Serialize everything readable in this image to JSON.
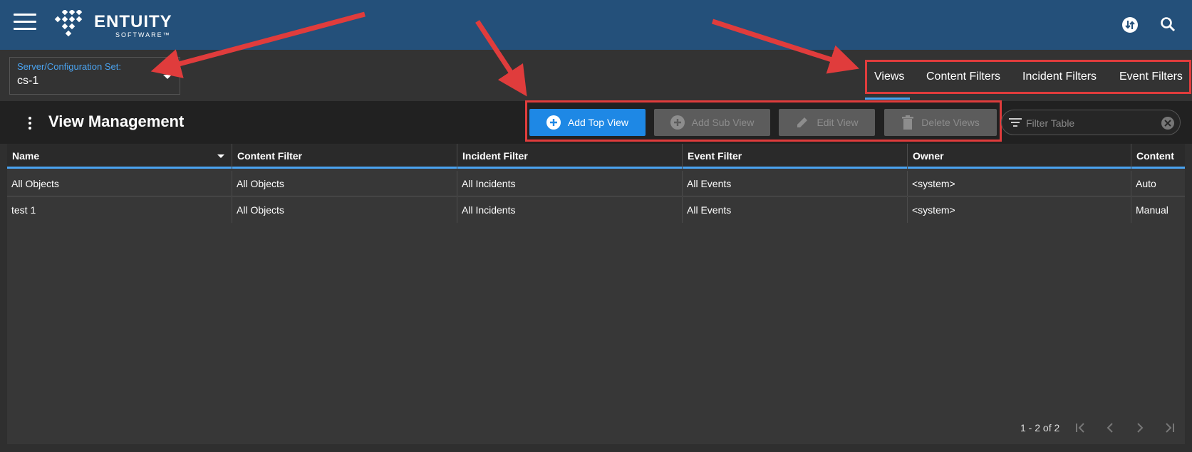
{
  "app": {
    "brand": "ENTUITY",
    "brand_sub": "SOFTWARE™"
  },
  "server_select": {
    "label": "Server/Configuration Set:",
    "value": "cs-1"
  },
  "tabs": [
    {
      "label": "Views",
      "active": true
    },
    {
      "label": "Content Filters",
      "active": false
    },
    {
      "label": "Incident Filters",
      "active": false
    },
    {
      "label": "Event Filters",
      "active": false
    }
  ],
  "page": {
    "title": "View Management"
  },
  "toolbar": {
    "add_top_view": "Add Top View",
    "add_sub_view": "Add Sub View",
    "edit_view": "Edit View",
    "delete_views": "Delete Views",
    "filter_placeholder": "Filter Table"
  },
  "table": {
    "columns": [
      "Name",
      "Content Filter",
      "Incident Filter",
      "Event Filter",
      "Owner",
      "Content"
    ],
    "rows": [
      [
        "All Objects",
        "All Objects",
        "All Incidents",
        "All Events",
        "<system>",
        "Auto"
      ],
      [
        "test 1",
        "All Objects",
        "All Incidents",
        "All Events",
        "<system>",
        "Manual"
      ]
    ]
  },
  "pagination": {
    "range_text": "1 - 2 of 2"
  },
  "colors": {
    "header_bg": "#24507a",
    "accent": "#4aa3f0",
    "primary_button": "#1e88e5",
    "annotation": "#e03c3c"
  }
}
